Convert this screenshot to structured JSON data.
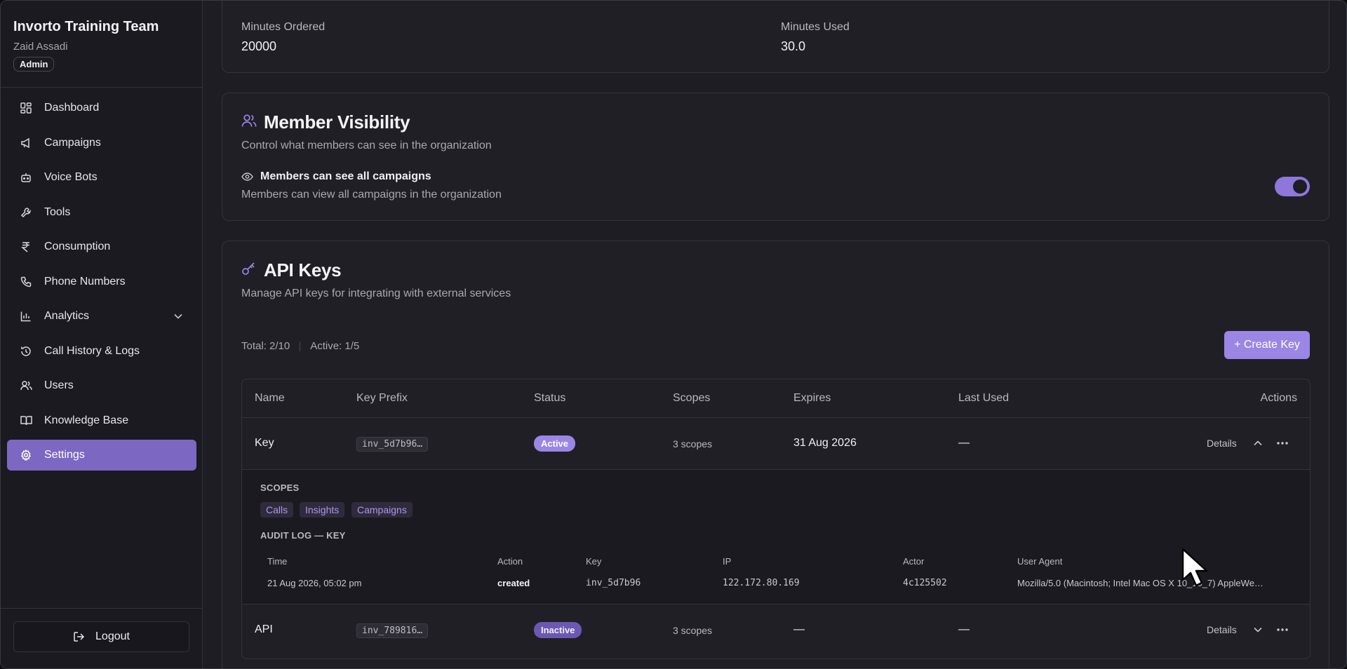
{
  "sidebar": {
    "org_name": "Invorto Training Team",
    "user_name": "Zaid Assadi",
    "role": "Admin",
    "items": [
      {
        "label": "Dashboard",
        "icon": "dashboard-icon"
      },
      {
        "label": "Campaigns",
        "icon": "megaphone-icon"
      },
      {
        "label": "Voice Bots",
        "icon": "bot-icon"
      },
      {
        "label": "Tools",
        "icon": "wrench-icon"
      },
      {
        "label": "Consumption",
        "icon": "rupee-icon"
      },
      {
        "label": "Phone Numbers",
        "icon": "phone-icon"
      },
      {
        "label": "Analytics",
        "icon": "bar-chart-icon"
      },
      {
        "label": "Call History & Logs",
        "icon": "history-icon"
      },
      {
        "label": "Users",
        "icon": "users-icon"
      },
      {
        "label": "Knowledge Base",
        "icon": "book-icon"
      },
      {
        "label": "Settings",
        "icon": "gear-icon",
        "active": true
      }
    ],
    "logout_label": "Logout"
  },
  "usage": {
    "minutes_ordered_label": "Minutes Ordered",
    "minutes_ordered_value": "20000",
    "minutes_used_label": "Minutes Used",
    "minutes_used_value": "30.0"
  },
  "visibility": {
    "title": "Member Visibility",
    "subtitle": "Control what members can see in the organization",
    "setting_title": "Members can see all campaigns",
    "setting_desc": "Members can view all campaigns in the organization",
    "toggle_on": true
  },
  "api_keys": {
    "title": "API Keys",
    "subtitle": "Manage API keys for integrating with external services",
    "total": "Total: 2/10",
    "active": "Active: 1/5",
    "create_label": "+ Create Key",
    "columns": [
      "Name",
      "Key Prefix",
      "Status",
      "Scopes",
      "Expires",
      "Last Used",
      "Actions"
    ],
    "rows": [
      {
        "name": "Key",
        "prefix": "inv_5d7b96…",
        "status": "Active",
        "scopes": "3 scopes",
        "expires": "31 Aug 2026",
        "last_used": "—",
        "details": "Details"
      },
      {
        "name": "API",
        "prefix": "inv_789816…",
        "status": "Inactive",
        "scopes": "3 scopes",
        "expires": "—",
        "last_used": "—",
        "details": "Details"
      }
    ],
    "expanded": {
      "scopes_label": "SCOPES",
      "scopes": [
        "Calls",
        "Insights",
        "Campaigns"
      ],
      "audit_label": "AUDIT LOG — KEY",
      "audit_columns": [
        "Time",
        "Action",
        "Key",
        "IP",
        "Actor",
        "User Agent"
      ],
      "audit_row": {
        "time": "21 Aug 2026, 05:02 pm",
        "action": "created",
        "key": "inv_5d7b96",
        "ip": "122.172.80.169",
        "actor": "4c125502",
        "user_agent": "Mozilla/5.0 (Macintosh; Intel Mac OS X 10_15_7) AppleWe…"
      }
    }
  },
  "colors": {
    "accent": "#9b86e6",
    "active_nav": "#7c67c2",
    "bg": "#1e1d24"
  }
}
